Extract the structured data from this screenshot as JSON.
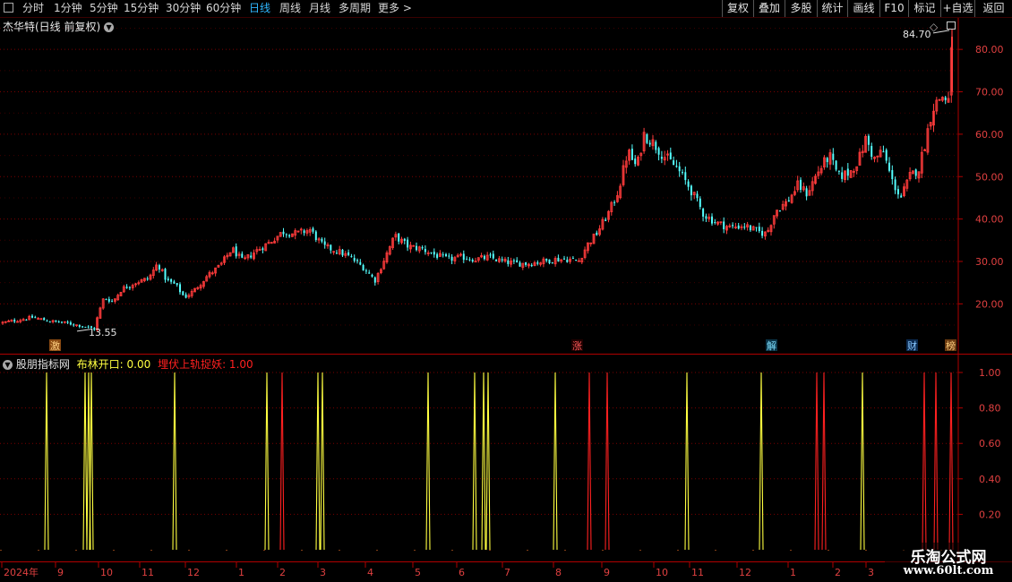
{
  "toolbar": {
    "periods": [
      "分时",
      "1分钟",
      "5分钟",
      "15分钟",
      "30分钟",
      "60分钟",
      "日线",
      "周线",
      "月线",
      "多周期",
      "更多"
    ],
    "active_period": "日线",
    "right_buttons": [
      "复权",
      "叠加",
      "多股",
      "统计",
      "画线",
      "F10",
      "标记",
      "+自选",
      "返回"
    ]
  },
  "main_chart": {
    "title": "杰华特(日线 前复权)",
    "high_label": "84.70",
    "low_label": "13.55",
    "markers": [
      "激",
      "涨",
      "解",
      "财",
      "榜"
    ],
    "y_ticks": [
      "80.00",
      "70.00",
      "60.00",
      "50.00",
      "40.00",
      "30.00",
      "20.00"
    ],
    "colors": {
      "up": "#ff3b3b",
      "down": "#54ffff",
      "grid": "#7a0000",
      "axis": "#b00000"
    }
  },
  "indicator": {
    "name": "股朋指标网",
    "line1_label": "布林开口: 0.00",
    "line2_label": "埋伏上轨捉妖: 1.00",
    "y_ticks": [
      "1.00",
      "0.80",
      "0.60",
      "0.40",
      "0.20"
    ],
    "colors": {
      "line1": "#ffff40",
      "line2": "#ff2020"
    }
  },
  "x_axis": {
    "labels": [
      "2024年",
      "9",
      "10",
      "11",
      "12",
      "1",
      "2",
      "3",
      "4",
      "5",
      "6",
      "7",
      "8",
      "9",
      "10",
      "11",
      "12",
      "1",
      "2",
      "3"
    ]
  },
  "chart_data": {
    "type": "candlestick",
    "title": "杰华特(日线 前复权)",
    "ylim": [
      10,
      87
    ],
    "max_price": 84.7,
    "min_price": 13.55,
    "close_path": [
      [
        0,
        15.5
      ],
      [
        20,
        16.2
      ],
      [
        35,
        16.8
      ],
      [
        55,
        15.9
      ],
      [
        75,
        15.4
      ],
      [
        95,
        14.6
      ],
      [
        105,
        14.0
      ],
      [
        108,
        17.0
      ],
      [
        115,
        21.5
      ],
      [
        125,
        20.5
      ],
      [
        135,
        23.5
      ],
      [
        150,
        25.0
      ],
      [
        165,
        26.0
      ],
      [
        175,
        29.5
      ],
      [
        185,
        25.5
      ],
      [
        195,
        24.5
      ],
      [
        205,
        21.5
      ],
      [
        215,
        23.0
      ],
      [
        230,
        26.5
      ],
      [
        245,
        29.0
      ],
      [
        258,
        33.0
      ],
      [
        270,
        30.0
      ],
      [
        285,
        32.5
      ],
      [
        300,
        34.5
      ],
      [
        315,
        37.0
      ],
      [
        330,
        36.5
      ],
      [
        345,
        37.5
      ],
      [
        360,
        33.5
      ],
      [
        375,
        32.5
      ],
      [
        390,
        31.0
      ],
      [
        405,
        28.5
      ],
      [
        418,
        25.5
      ],
      [
        428,
        30.5
      ],
      [
        440,
        36.0
      ],
      [
        455,
        33.5
      ],
      [
        470,
        33.0
      ],
      [
        485,
        31.5
      ],
      [
        500,
        30.5
      ],
      [
        515,
        31.0
      ],
      [
        530,
        30.5
      ],
      [
        545,
        31.0
      ],
      [
        560,
        30.0
      ],
      [
        575,
        29.5
      ],
      [
        590,
        29.5
      ],
      [
        605,
        30.0
      ],
      [
        620,
        30.5
      ],
      [
        635,
        30.5
      ],
      [
        645,
        30.0
      ],
      [
        655,
        34.0
      ],
      [
        665,
        36.5
      ],
      [
        680,
        42.0
      ],
      [
        690,
        47.0
      ],
      [
        700,
        56.0
      ],
      [
        710,
        52.0
      ],
      [
        718,
        60.0
      ],
      [
        728,
        58.0
      ],
      [
        740,
        55.0
      ],
      [
        755,
        52.0
      ],
      [
        770,
        47.0
      ],
      [
        785,
        41.0
      ],
      [
        800,
        39.0
      ],
      [
        815,
        38.0
      ],
      [
        830,
        38.5
      ],
      [
        845,
        37.0
      ],
      [
        855,
        36.5
      ],
      [
        865,
        42.0
      ],
      [
        878,
        44.0
      ],
      [
        890,
        48.0
      ],
      [
        900,
        46.0
      ],
      [
        912,
        51.0
      ],
      [
        925,
        55.0
      ],
      [
        935,
        50.0
      ],
      [
        948,
        51.0
      ],
      [
        958,
        54.0
      ],
      [
        966,
        59.0
      ],
      [
        975,
        54.0
      ],
      [
        985,
        56.0
      ],
      [
        995,
        49.0
      ],
      [
        1005,
        45.0
      ],
      [
        1015,
        50.0
      ],
      [
        1025,
        52.0
      ],
      [
        1032,
        58.0
      ],
      [
        1040,
        66.0
      ],
      [
        1050,
        69.0
      ],
      [
        1058,
        68.0
      ],
      [
        1063,
        84.7
      ]
    ],
    "indicator_series": [
      {
        "name": "布林开口",
        "spike_x": [
          52,
          95,
          99,
          102,
          195,
          298,
          355,
          360,
          478,
          530,
          540,
          545,
          620,
          767,
          850,
          963
        ]
      },
      {
        "name": "埋伏上轨捉妖",
        "spike_x": [
          315,
          658,
          678,
          912,
          920,
          1032,
          1045,
          1062
        ]
      }
    ]
  },
  "watermark": {
    "line1": "乐淘公式网",
    "line2": "www.60lt.com"
  }
}
